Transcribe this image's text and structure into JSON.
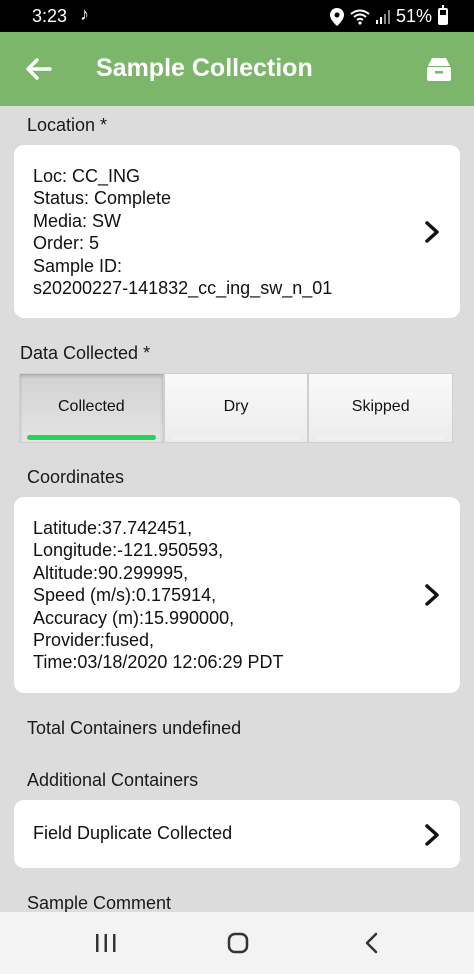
{
  "status_bar": {
    "time": "3:23",
    "music_icon": "music-note-icon",
    "battery": "51%"
  },
  "app_bar": {
    "title": "Sample Collection",
    "color": "#7cb66a"
  },
  "location": {
    "label": "Location *",
    "lines": [
      "Loc: CC_ING",
      "Status: Complete",
      "Media: SW",
      "Order: 5",
      "Sample ID:",
      "s20200227-141832_cc_ing_sw_n_01"
    ]
  },
  "data_collected": {
    "label": "Data Collected *",
    "options": [
      "Collected",
      "Dry",
      "Skipped"
    ],
    "selected": "Collected",
    "indicator_color": "#21d55a"
  },
  "coordinates": {
    "label": "Coordinates",
    "lines": [
      "Latitude:37.742451,",
      "Longitude:-121.950593,",
      "Altitude:90.299995,",
      "Speed (m/s):0.175914,",
      "Accuracy (m):15.990000,",
      "Provider:fused,",
      "Time:03/18/2020 12:06:29 PDT"
    ]
  },
  "total_containers": "Total Containers undefined",
  "additional_containers": {
    "label": "Additional Containers",
    "item": "Field Duplicate Collected"
  },
  "sample_comment": {
    "label": "Sample Comment"
  }
}
